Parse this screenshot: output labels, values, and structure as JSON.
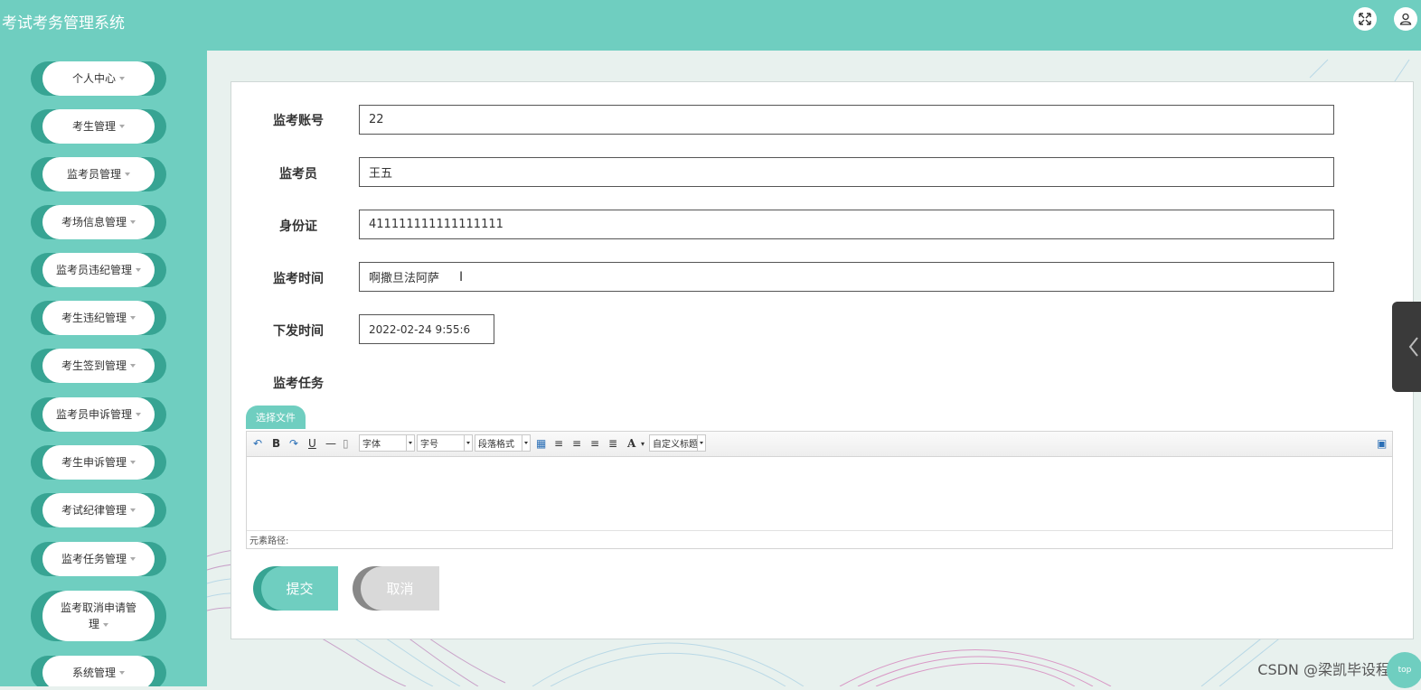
{
  "header": {
    "title": "考试考务管理系统",
    "fullscreen_icon": "fullscreen-icon",
    "user_icon": "user-icon"
  },
  "sidebar": {
    "items": [
      {
        "label": "个人中心"
      },
      {
        "label": "考生管理"
      },
      {
        "label": "监考员管理"
      },
      {
        "label": "考场信息管理"
      },
      {
        "label": "监考员违纪管理"
      },
      {
        "label": "考生违纪管理"
      },
      {
        "label": "考生签到管理"
      },
      {
        "label": "监考员申诉管理"
      },
      {
        "label": "考生申诉管理"
      },
      {
        "label": "考试纪律管理"
      },
      {
        "label": "监考任务管理"
      },
      {
        "label": "监考取消申请管",
        "label2": "理"
      },
      {
        "label": "系统管理"
      }
    ]
  },
  "form": {
    "account_label": "监考账号",
    "account_value": "22",
    "proctor_label": "监考员",
    "proctor_value": "王五",
    "id_label": "身份证",
    "id_value": "411111111111111111",
    "time_label": "监考时间",
    "time_value": "啊撒旦法阿萨",
    "issue_label": "下发时间",
    "issue_value": "2022-02-24 9:55:6",
    "task_label": "监考任务",
    "choose_file": "选择文件"
  },
  "editor": {
    "font_select": "字体",
    "size_select": "字号",
    "para_select": "段落格式",
    "custom_title": "自定义标题",
    "path_label": "元素路径:"
  },
  "buttons": {
    "submit": "提交",
    "cancel": "取消"
  },
  "watermark": "CSDN @梁凯毕设程序",
  "top_bubble": "top",
  "colors": {
    "primary": "#6fcec0",
    "primary_dark": "#37a493"
  }
}
